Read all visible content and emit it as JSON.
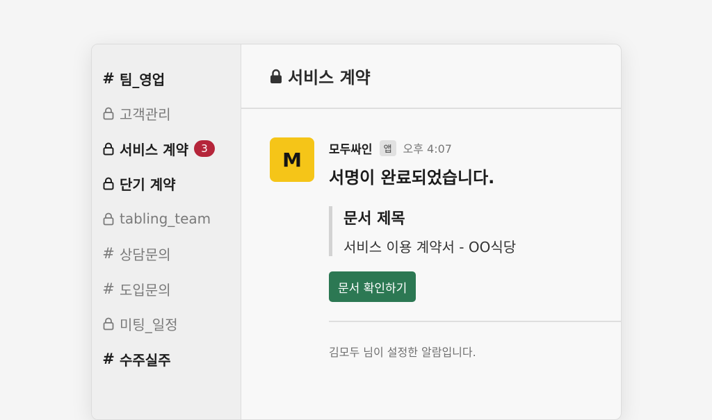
{
  "sidebar": {
    "channels": [
      {
        "type": "hash",
        "name": "팀_영업",
        "bold": true
      },
      {
        "type": "lock",
        "name": "고객관리",
        "bold": false
      },
      {
        "type": "lock",
        "name": "서비스 계약",
        "bold": true,
        "badge": "3"
      },
      {
        "type": "lock",
        "name": "단기 계약",
        "bold": true
      },
      {
        "type": "lock",
        "name": "tabling_team",
        "bold": false
      },
      {
        "type": "hash",
        "name": "상담문의",
        "bold": false
      },
      {
        "type": "hash",
        "name": "도입문의",
        "bold": false
      },
      {
        "type": "lock",
        "name": "미팅_일정",
        "bold": false
      },
      {
        "type": "hash",
        "name": "수주실주",
        "bold": true
      }
    ],
    "hash_symbol": "#"
  },
  "header": {
    "title": "서비스 계약"
  },
  "message": {
    "avatar_letter": "M",
    "sender": "모두싸인",
    "app_tag": "앱",
    "time": "오후 4:07",
    "title": "서명이 완료되었습니다.",
    "field_label": "문서 제목",
    "field_value": "서비스 이용 계약서 - OO식당",
    "button_label": "문서 확인하기",
    "footnote": "김모두 님이 설정한 알람입니다."
  },
  "colors": {
    "badge": "#b5253a",
    "button": "#2c7853",
    "avatar": "#f5c518"
  }
}
